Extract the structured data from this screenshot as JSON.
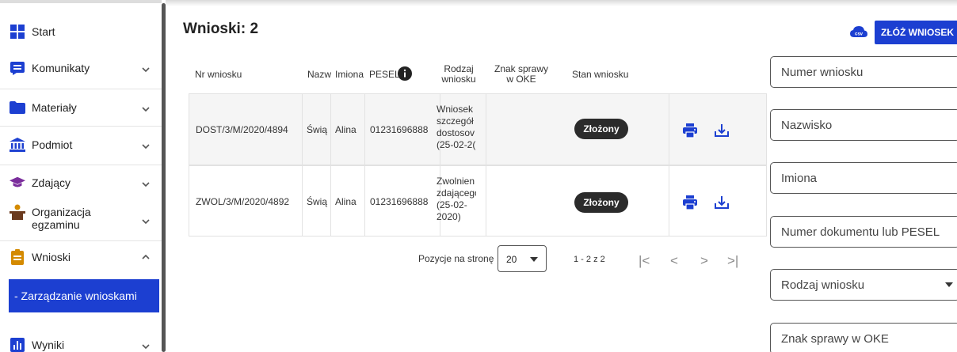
{
  "sidebar": {
    "items": [
      {
        "label": "Start"
      },
      {
        "label": "Komunikaty"
      },
      {
        "label": "Materiały"
      },
      {
        "label": "Podmiot"
      },
      {
        "label": "Zdający"
      },
      {
        "label": "Organizacja egzaminu"
      },
      {
        "label": "Wnioski"
      },
      {
        "label": "Wyniki"
      }
    ],
    "sub_item": "- Zarządzanie wnioskami"
  },
  "header": {
    "title": "Wnioski: 2",
    "csv_label": "csv",
    "submit_label": "ZŁÓŻ WNIOSEK"
  },
  "table": {
    "columns": [
      "Nr wniosku",
      "Nazw",
      "Imiona",
      "PESEL",
      "Rodzaj wniosku",
      "Znak sprawy w OKE",
      "Stan wniosku"
    ],
    "rows": [
      {
        "nr": "DOST/3/M/2020/4894",
        "nazw": "Świą",
        "imiona": "Alina",
        "pesel": "01231696888",
        "rodzaj": [
          "Wniosek",
          "szczegół",
          "dostosov",
          "(25-02-2("
        ],
        "znak": "",
        "stan": "Złożony"
      },
      {
        "nr": "ZWOL/3/M/2020/4892",
        "nazw": "Świą",
        "imiona": "Alina",
        "pesel": "01231696888",
        "rodzaj": [
          "Zwolnien",
          "zdającego",
          "(25-02-",
          "2020)"
        ],
        "znak": "",
        "stan": "Złożony"
      }
    ]
  },
  "pagination": {
    "label": "Pozycje na stronę",
    "per_page": "20",
    "range": "1 - 2 z 2",
    "first": "|<",
    "prev": "<",
    "next": ">",
    "last": ">|"
  },
  "filters": {
    "numer": "Numer wniosku",
    "nazwisko": "Nazwisko",
    "imiona": "Imiona",
    "dokument": "Numer dokumentu lub PESEL",
    "rodzaj": "Rodzaj wniosku",
    "znak": "Znak sprawy w OKE"
  },
  "colors": {
    "primary": "#1c3fd1",
    "badge": "#2b2b2b",
    "nav_icon": "#1c3fd1",
    "zdajacy_icon": "#7b2e9c",
    "wnioski_icon": "#d48a00"
  }
}
